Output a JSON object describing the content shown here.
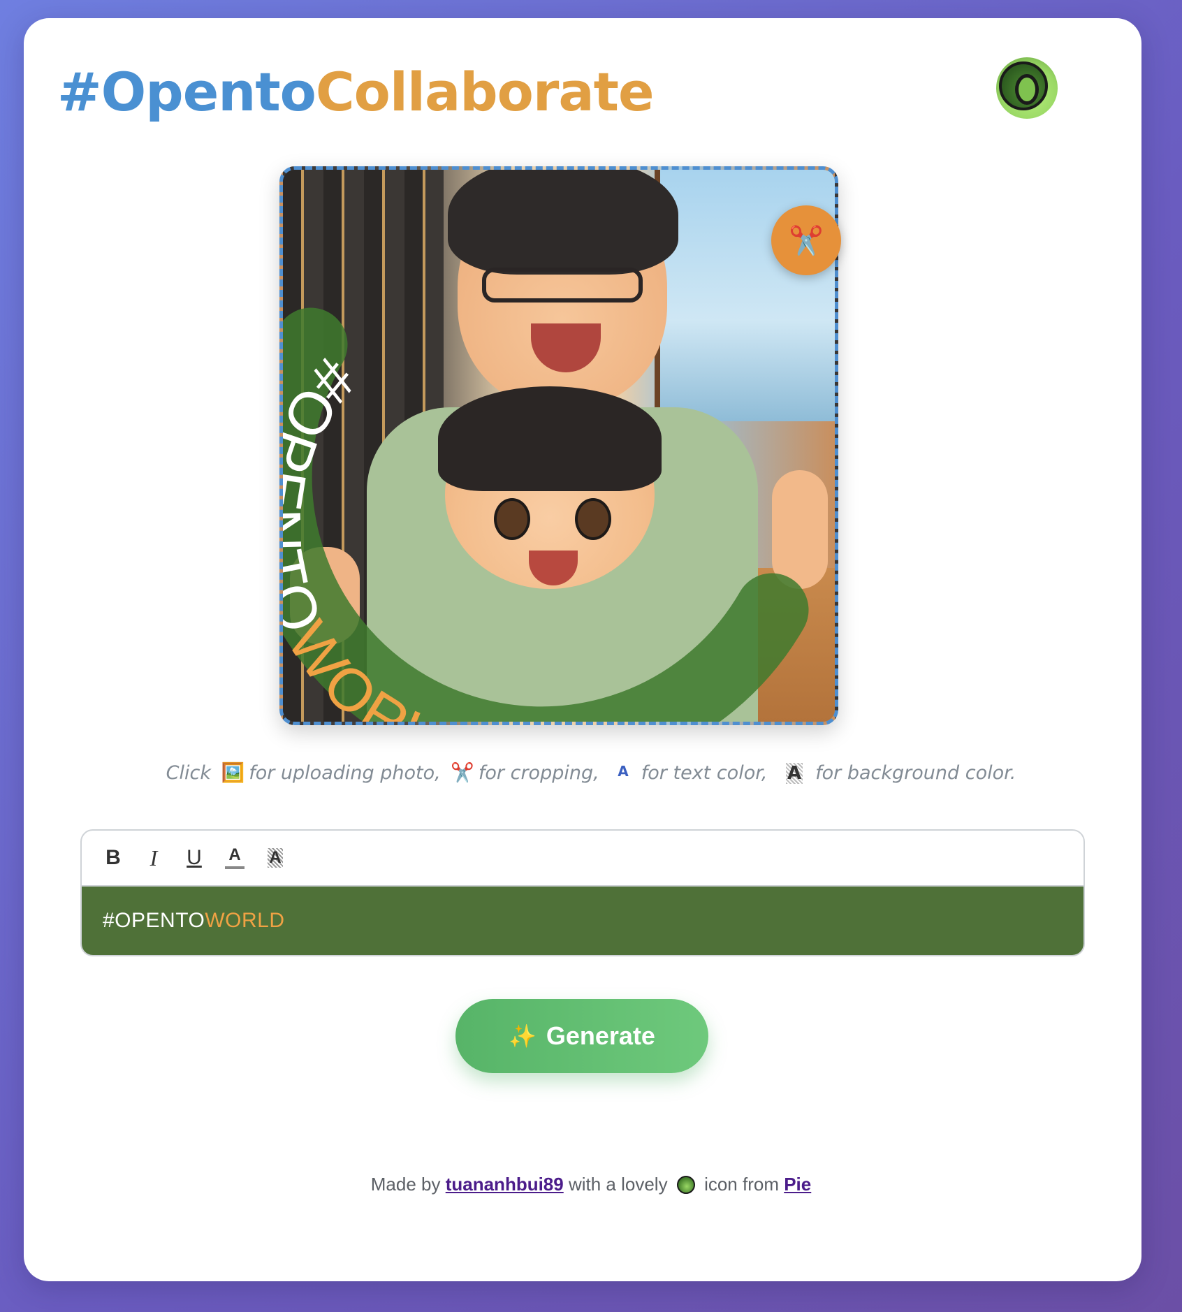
{
  "header": {
    "title_part1": "#Opento",
    "title_part2": "Collaborate"
  },
  "preview": {
    "badge_text_white": "#OPENTO",
    "badge_text_orange": "WORLD",
    "crop_icon": "✂️"
  },
  "hint": {
    "click": "Click",
    "upload_icon": "🖼️",
    "upload_text": "for uploading photo,",
    "crop_icon": "✂️",
    "crop_text": "for cropping,",
    "text_color_icon": "A",
    "text_color_text": "for text color,",
    "bg_color_icon": "A",
    "bg_color_text": "for background color."
  },
  "editor": {
    "toolbar": {
      "bold": "B",
      "italic": "I",
      "underline": "U",
      "text_color": "A",
      "bg_color": "A"
    },
    "content_white": "#OPENTO",
    "content_orange": "WORLD",
    "background_color": "#4f7138",
    "highlight_color": "#f0a244"
  },
  "generate": {
    "icon": "✨",
    "label": "Generate"
  },
  "footer": {
    "made_by": "Made by",
    "author": "tuananhbui89",
    "with_lovely": "with a lovely",
    "icon_from": "icon from",
    "source": "Pie"
  },
  "colors": {
    "title_blue": "#4a90d2",
    "title_orange": "#e19f43",
    "generate_green": "#57b468",
    "crop_orange": "#e6913a"
  }
}
